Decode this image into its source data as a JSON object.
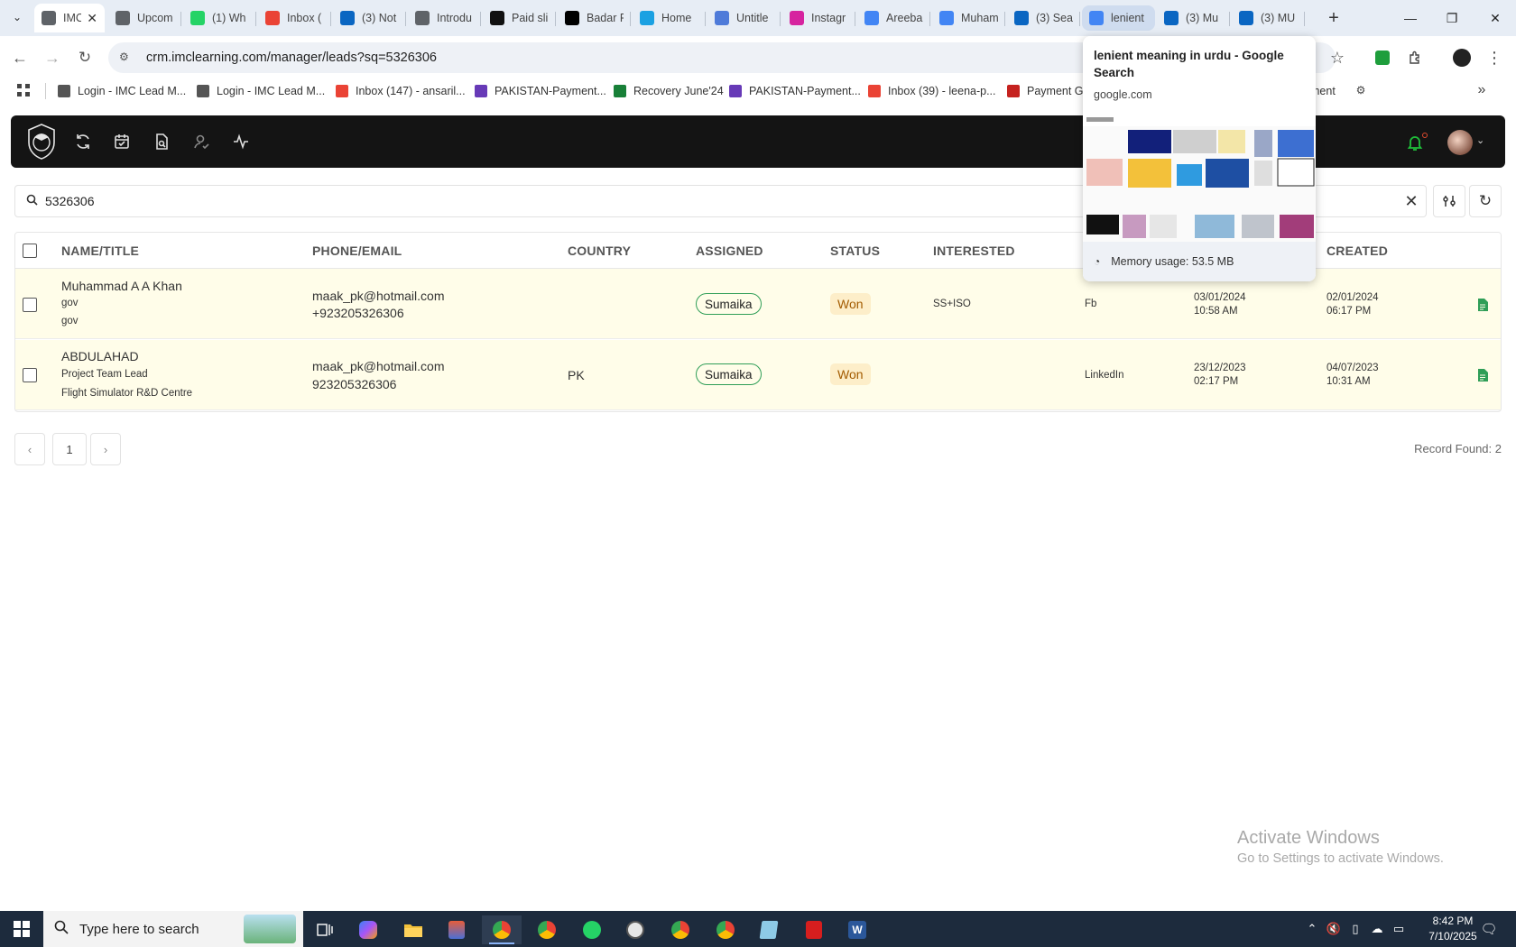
{
  "browser": {
    "tabs": [
      {
        "label": "IMC",
        "active": true,
        "color": "#5f6368"
      },
      {
        "label": "Upcom",
        "color": "#5f6368"
      },
      {
        "label": "(1) Wh",
        "color": "#25d366"
      },
      {
        "label": "Inbox (",
        "color": "#ea4335"
      },
      {
        "label": "(3) Not",
        "color": "#0a66c2"
      },
      {
        "label": "Introdu",
        "color": "#5f6368"
      },
      {
        "label": "Paid sli",
        "color": "#111111"
      },
      {
        "label": "Badar F",
        "color": "#000000"
      },
      {
        "label": "Home",
        "color": "#1ba1e2"
      },
      {
        "label": "Untitle",
        "color": "#4f7bd9"
      },
      {
        "label": "Instagr",
        "color": "#d6249f"
      },
      {
        "label": "Areeba",
        "color": "#4285f4"
      },
      {
        "label": "Muham",
        "color": "#4285f4"
      },
      {
        "label": "(3) Sea",
        "color": "#0a66c2"
      },
      {
        "label": "lenient",
        "hovered": true,
        "color": "#4285f4"
      },
      {
        "label": "(3) Mu",
        "color": "#0a66c2"
      },
      {
        "label": "(3) MU",
        "color": "#0a66c2"
      }
    ],
    "url": "crm.imclearning.com/manager/leads?sq=5326306",
    "bookmarks": [
      {
        "label": "Login - IMC Lead M...",
        "color": "#555555"
      },
      {
        "label": "Login - IMC Lead M...",
        "color": "#555555"
      },
      {
        "label": "Inbox (147) - ansaril...",
        "color": "#ea4335"
      },
      {
        "label": "PAKISTAN-Payment...",
        "color": "#673ab7"
      },
      {
        "label": "Recovery June'24",
        "color": "#188038"
      },
      {
        "label": "PAKISTAN-Payment...",
        "color": "#673ab7"
      },
      {
        "label": "Inbox (39) - leena-p...",
        "color": "#ea4335"
      },
      {
        "label": "Payment Ga",
        "color": "#c5221f"
      },
      {
        "label": "ment",
        "color": "#555555"
      }
    ],
    "hover_card": {
      "title": "lenient meaning in urdu - Google Search",
      "domain": "google.com",
      "memory": "Memory usage: 53.5 MB"
    }
  },
  "app": {
    "search": {
      "value": "5326306"
    },
    "columns": [
      "NAME/TITLE",
      "PHONE/EMAIL",
      "COUNTRY",
      "ASSIGNED",
      "STATUS",
      "INTERESTED",
      "CREATED"
    ],
    "rows": [
      {
        "name": "Muhammad A A Khan",
        "title1": "gov",
        "title2": "gov",
        "email": "maak_pk@hotmail.com",
        "phone": "+923205326306",
        "country": "",
        "assigned": "Sumaika",
        "status": "Won",
        "interested": "SS+ISO",
        "source": "Fb",
        "updated_date": "03/01/2024",
        "updated_time": "10:58 AM",
        "created_date": "02/01/2024",
        "created_time": "06:17 PM"
      },
      {
        "name": "ABDULAHAD",
        "title1": "Project Team Lead",
        "title2": "Flight Simulator R&D Centre",
        "email": "maak_pk@hotmail.com",
        "phone": "923205326306",
        "country": "PK",
        "assigned": "Sumaika",
        "status": "Won",
        "interested": "",
        "source": "LinkedIn",
        "updated_date": "23/12/2023",
        "updated_time": "02:17 PM",
        "created_date": "04/07/2023",
        "created_time": "10:31 AM"
      }
    ],
    "pagination": {
      "prev": "‹",
      "page": "1",
      "next": "›"
    },
    "record_found": "Record Found: 2"
  },
  "watermark": {
    "line1": "Activate Windows",
    "line2": "Go to Settings to activate Windows."
  },
  "taskbar": {
    "search_placeholder": "Type here to search",
    "time": "8:42 PM",
    "date": "7/10/2025"
  },
  "colors": {
    "app_header": "#141414",
    "row_highlight": "#fffde9",
    "accent_green": "#2f9e57",
    "won_bg": "#fdeec9",
    "won_text": "#a35b00",
    "taskbar": "#1d2b3d"
  }
}
